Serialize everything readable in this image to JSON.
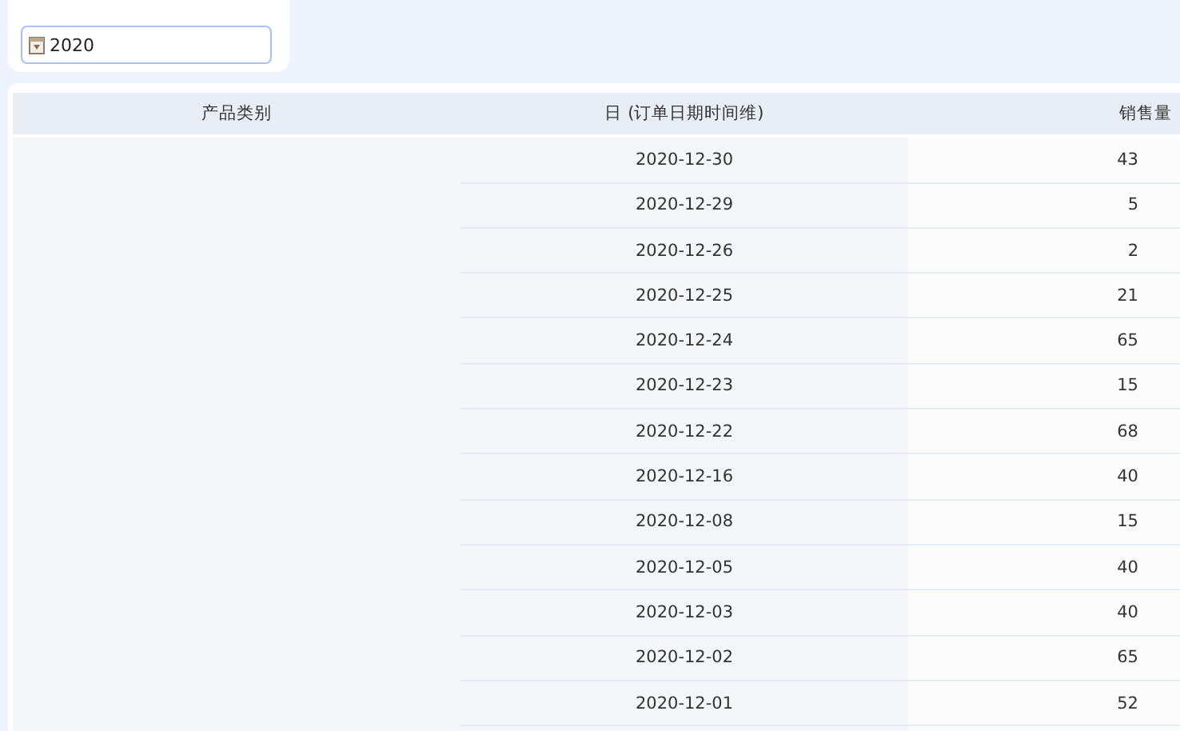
{
  "filter": {
    "value": "2020"
  },
  "table": {
    "columns": [
      "产品类别",
      "日 (订单日期时间维)",
      "销售量"
    ],
    "rows": [
      {
        "date": "2020-12-30",
        "sales": "43"
      },
      {
        "date": "2020-12-29",
        "sales": "5"
      },
      {
        "date": "2020-12-26",
        "sales": "2"
      },
      {
        "date": "2020-12-25",
        "sales": "21"
      },
      {
        "date": "2020-12-24",
        "sales": "65"
      },
      {
        "date": "2020-12-23",
        "sales": "15"
      },
      {
        "date": "2020-12-22",
        "sales": "68"
      },
      {
        "date": "2020-12-16",
        "sales": "40"
      },
      {
        "date": "2020-12-08",
        "sales": "15"
      },
      {
        "date": "2020-12-05",
        "sales": "40"
      },
      {
        "date": "2020-12-03",
        "sales": "40"
      },
      {
        "date": "2020-12-02",
        "sales": "65"
      },
      {
        "date": "2020-12-01",
        "sales": "52"
      }
    ]
  }
}
